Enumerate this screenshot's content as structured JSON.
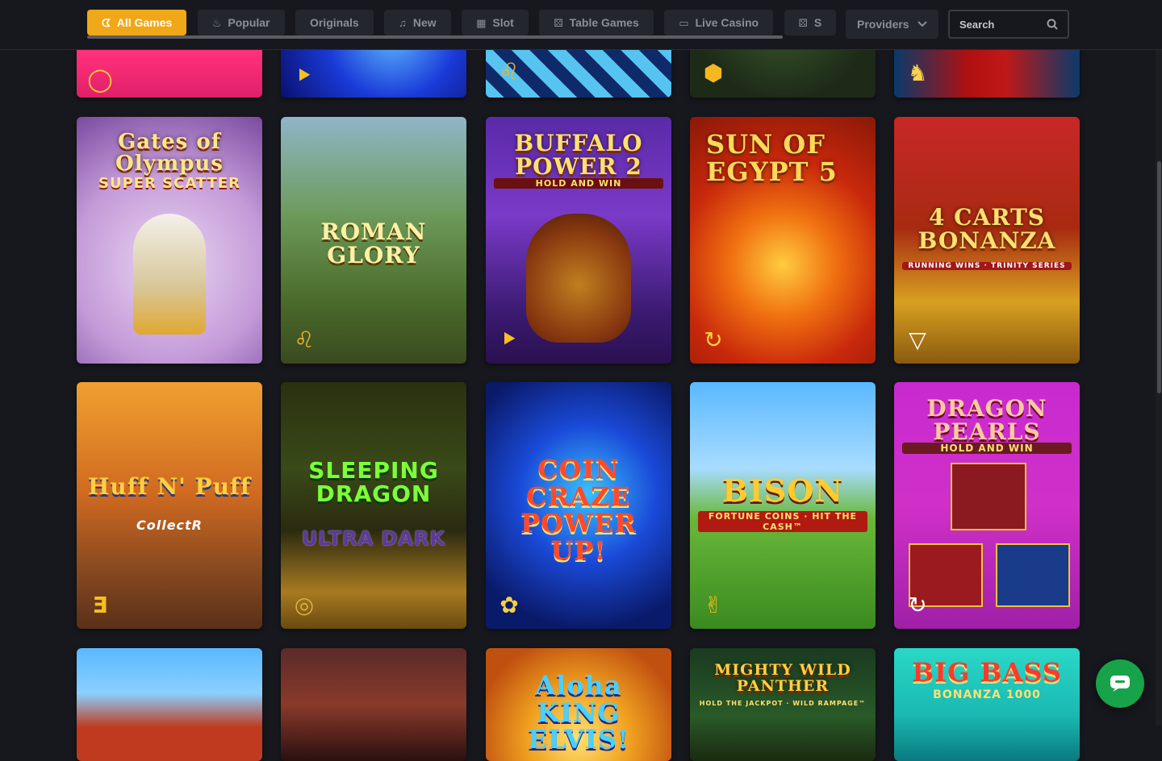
{
  "nav": {
    "tabs": [
      {
        "label": "All Games",
        "icon": "cherry-icon"
      },
      {
        "label": "Popular",
        "icon": "flame-icon"
      },
      {
        "label": "Originals",
        "icon": ""
      },
      {
        "label": "New",
        "icon": "bell-icon"
      },
      {
        "label": "Slot",
        "icon": "slot-machine-icon"
      },
      {
        "label": "Table Games",
        "icon": "dice-icon"
      },
      {
        "label": "Live Casino",
        "icon": "video-camera-icon"
      },
      {
        "label": "S",
        "icon": "dice-icon"
      }
    ],
    "providers_label": "Providers",
    "search_placeholder": "Search"
  },
  "games_row1_partial": [
    {
      "provider_icon": "cherry-icon"
    },
    {
      "provider_icon": "play-forward-icon"
    },
    {
      "provider_icon": "lion-icon"
    },
    {
      "provider_icon": "s-hexagon-icon"
    },
    {
      "provider_icon": "fox-icon"
    }
  ],
  "games_row2": [
    {
      "title": "Gates of Olympus",
      "subtitle": "SUPER SCATTER",
      "provider_icon": ""
    },
    {
      "title": "ROMAN GLORY",
      "subtitle": "",
      "provider_icon": "lion-icon"
    },
    {
      "title": "BUFFALO POWER 2",
      "subtitle": "HOLD AND WIN",
      "provider_icon": "play-forward-icon"
    },
    {
      "title": "SUN OF EGYPT 5",
      "subtitle": "",
      "provider_icon": "spiral-icon"
    },
    {
      "title": "4 CARTS BONANZA",
      "subtitle": "RUNNING WINS · TRINITY SERIES",
      "provider_icon": "triangle-icon"
    }
  ],
  "games_row3": [
    {
      "title": "Huff N' Puff",
      "subtitle": "CollectR",
      "provider_icon": "e-logo-icon"
    },
    {
      "title": "SLEEPING DRAGON",
      "subtitle": "ULTRA DARK",
      "provider_icon": "coin-icon"
    },
    {
      "title": "COIN CRAZE POWER UP!",
      "subtitle": "",
      "provider_icon": "puzzle-icon"
    },
    {
      "title": "BISON",
      "subtitle": "FORTUNE COINS · HIT THE CASH™",
      "provider_icon": "hand-icon"
    },
    {
      "title": "DRAGON PEARLS",
      "subtitle": "HOLD AND WIN",
      "provider_icon": "spiral-icon"
    }
  ],
  "games_row4_partial": [
    {
      "title": "",
      "subtitle": ""
    },
    {
      "title": "",
      "subtitle": ""
    },
    {
      "title": "Aloha KING ELVIS!",
      "subtitle": ""
    },
    {
      "title": "MIGHTY WILD PANTHER",
      "subtitle": "HOLD THE JACKPOT · WILD RAMPAGE™"
    },
    {
      "title": "BIG BASS",
      "subtitle": "BONANZA 1000"
    }
  ],
  "colors": {
    "accent": "#f0a818",
    "background": "#16181d",
    "chat": "#17a34a"
  }
}
